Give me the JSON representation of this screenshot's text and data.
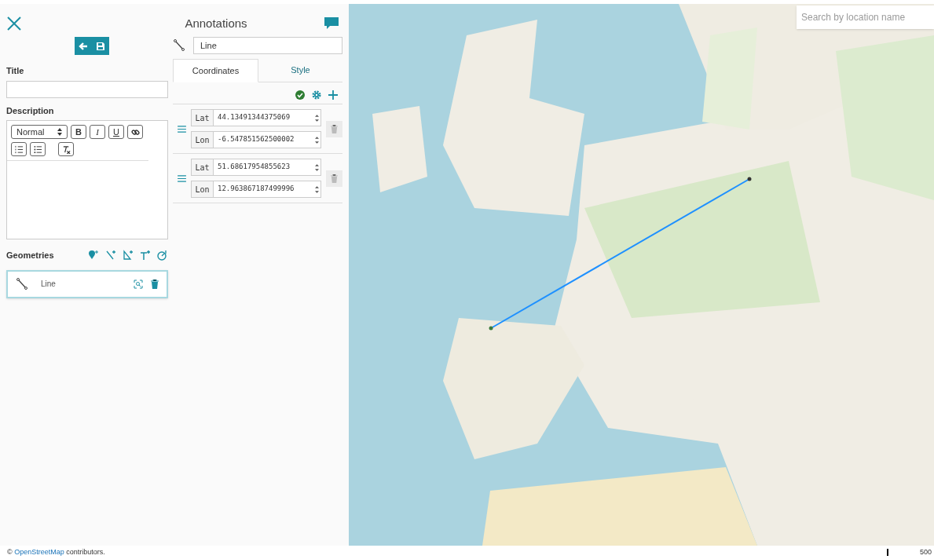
{
  "panel": {
    "title": "Annotations"
  },
  "form": {
    "title_label": "Title",
    "description_label": "Description",
    "format_select": "Normal",
    "format_buttons": [
      {
        "kind": "bold",
        "label": "B"
      },
      {
        "kind": "italic",
        "label": "I"
      },
      {
        "kind": "underline",
        "label": "U"
      },
      {
        "kind": "link"
      },
      {
        "kind": "ordered-list"
      },
      {
        "kind": "bullet-list"
      },
      {
        "kind": "clear-format"
      }
    ],
    "geometries_label": "Geometries",
    "geometries": [
      {
        "name": "Line",
        "selected": true
      }
    ]
  },
  "geometry_editor": {
    "name": "Line",
    "tabs": [
      {
        "label": "Coordinates",
        "selected": true
      },
      {
        "label": "Style",
        "selected": false
      }
    ],
    "points": [
      {
        "lat_label": "Lat",
        "lat": "44.13491344375069",
        "lon_label": "Lon",
        "lon": "-6.547851562500002"
      },
      {
        "lat_label": "Lat",
        "lon_label": "Lon",
        "lat": "51.68617954855623",
        "lon": "12.963867187499996"
      }
    ]
  },
  "map": {
    "search": {
      "placeholder": "Search by location name"
    }
  },
  "footer": {
    "attribution_prefix": "©",
    "attribution_link": "OpenStreetMap",
    "attribution_suffix": "contributors.",
    "scale": "500"
  }
}
